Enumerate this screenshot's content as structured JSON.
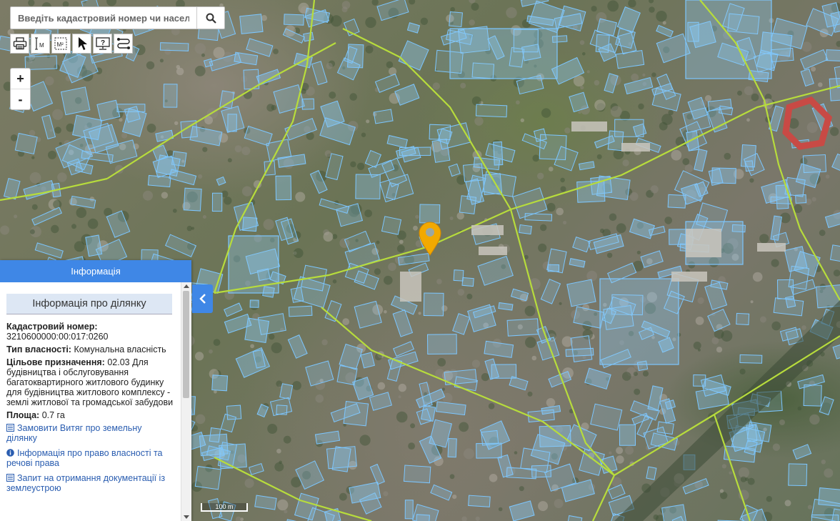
{
  "search": {
    "placeholder": "Введіть кадастровий номер чи населений пункт"
  },
  "toolbar": {
    "tools": [
      {
        "name": "print-icon"
      },
      {
        "name": "measure-length-icon",
        "label": "M"
      },
      {
        "name": "measure-area-icon",
        "label": "M²"
      },
      {
        "name": "pointer-icon"
      },
      {
        "name": "help-screen-icon"
      },
      {
        "name": "route-icon"
      }
    ]
  },
  "zoom": {
    "in_label": "+",
    "out_label": "-"
  },
  "panel": {
    "header": "Інформація",
    "subhead": "Інформація про ділянку",
    "cadastral_label": "Кадастровий номер:",
    "cadastral_value": "3210600000:00:017:0260",
    "ownership_label": "Тип власності:",
    "ownership_value": "Комунальна власність",
    "purpose_label": "Цільове призначення:",
    "purpose_value": "02.03 Для будівництва і обслуговування багатоквартирного житлового будинку для будівництва житлового комплексу - землі житлової та громадської забудови",
    "area_label": "Площа:",
    "area_value": "0.7 га",
    "links": [
      "Замовити Витяг про земельну ділянку",
      "Інформація про право власності та речові права",
      "Запит на отримання документації із землеустрою"
    ]
  },
  "scale": {
    "label": "100 m"
  },
  "colors": {
    "parcel_stroke": "#7cc6ff",
    "parcel_fill": "#8cc8f0",
    "road_line": "#b7dc3c",
    "marker": "#f2a900",
    "panel_header": "#3f87e6"
  }
}
